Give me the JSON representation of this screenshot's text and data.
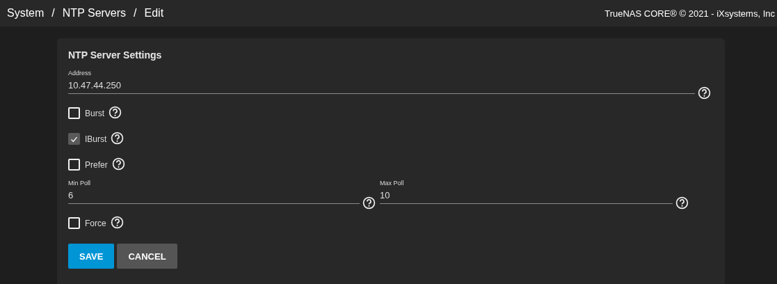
{
  "breadcrumb": {
    "items": [
      "System",
      "NTP Servers",
      "Edit"
    ],
    "separator": "/"
  },
  "copyright": "TrueNAS CORE® © 2021 - iXsystems, Inc",
  "card": {
    "title": "NTP Server Settings",
    "rows": [
      {
        "kind": "inputs",
        "inputs": [
          {
            "label": "Address",
            "value": "10.47.44.250"
          }
        ]
      },
      {
        "kind": "checkbox",
        "label": "Burst",
        "checked": false
      },
      {
        "kind": "checkbox",
        "label": "IBurst",
        "checked": true
      },
      {
        "kind": "checkbox",
        "label": "Prefer",
        "checked": false
      },
      {
        "kind": "inputs",
        "inputs": [
          {
            "label": "Min Poll",
            "value": "6"
          },
          {
            "label": "Max Poll",
            "value": "10"
          }
        ]
      },
      {
        "kind": "checkbox",
        "label": "Force",
        "checked": false
      }
    ],
    "buttons": [
      {
        "label": "SAVE",
        "kind": "primary"
      },
      {
        "label": "CANCEL",
        "kind": "secondary"
      }
    ]
  }
}
